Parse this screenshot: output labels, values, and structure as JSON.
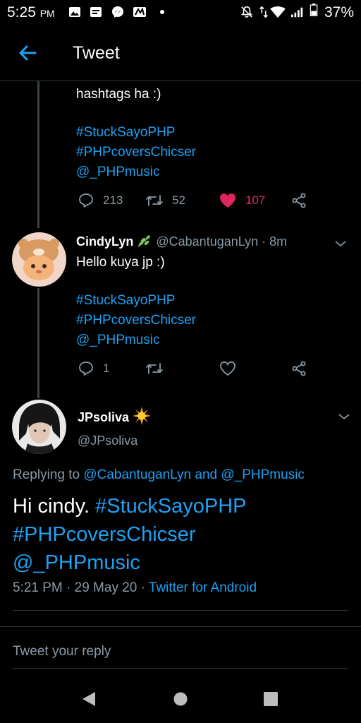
{
  "status_bar": {
    "time": "5:25",
    "ampm": "PM",
    "battery": "37%"
  },
  "header": {
    "title": "Tweet"
  },
  "tweet1": {
    "text_line_1": "hashtags ha :)",
    "hashtag_1": "#StuckSayoPHP",
    "hashtag_2": "#PHPcoversChicser",
    "mention": "@_PHPmusic",
    "replies": "213",
    "retweets": "52",
    "likes": "107"
  },
  "tweet2": {
    "display_name": "CindyLyn",
    "handle_time": " @CabantuganLyn · 8m",
    "text": "Hello kuya jp :)",
    "hashtag_1": "#StuckSayoPHP",
    "hashtag_2": "#PHPcoversChicser",
    "mention": "@_PHPmusic",
    "replies": "1"
  },
  "main_tweet": {
    "display_name": "JPsoliva",
    "handle": "@JPsoliva",
    "replying_prefix": "Replying to ",
    "replying_user1": "@CabantuganLyn",
    "replying_and": " and ",
    "replying_user2": "@_PHPmusic",
    "text_start": "Hi cindy. ",
    "hashtag_1": "#StuckSayoPHP",
    "hashtag_2": "#PHPcoversChicser",
    "mention": "@_PHPmusic",
    "time": "5:21 PM · 29 May 20 · ",
    "source": "Twitter for Android"
  },
  "reply": {
    "placeholder": "Tweet your reply"
  },
  "colors": {
    "background": "#000000",
    "link": "#1da1f2",
    "muted": "#8899a6",
    "like": "#e0245e"
  }
}
